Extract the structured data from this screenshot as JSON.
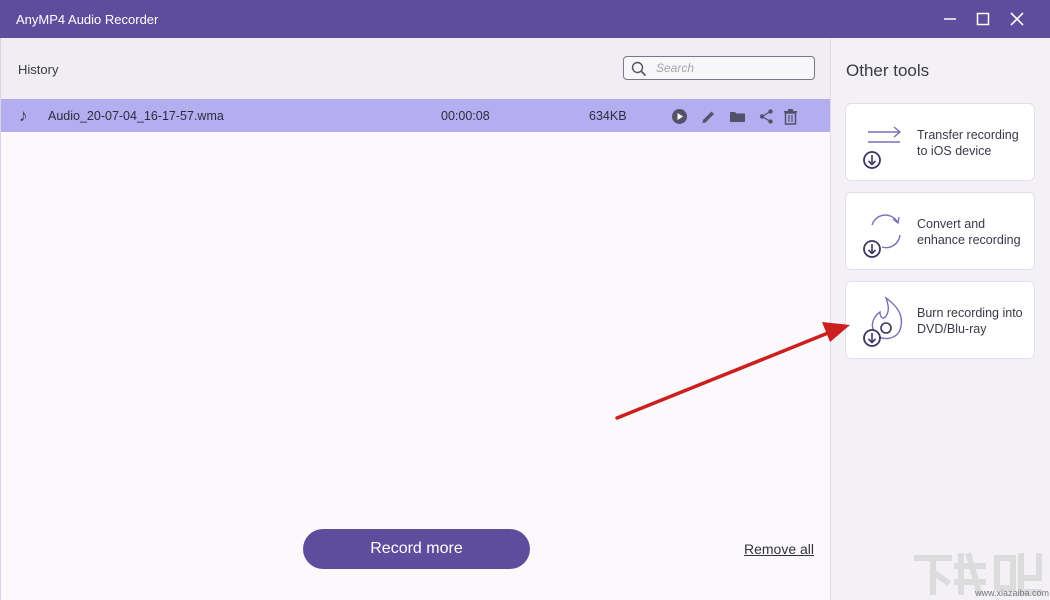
{
  "window": {
    "title": "AnyMP4 Audio Recorder"
  },
  "history": {
    "label": "History",
    "search_placeholder": "Search",
    "items": [
      {
        "filename": "Audio_20-07-04_16-17-57.wma",
        "duration": "00:00:08",
        "size": "634KB"
      }
    ]
  },
  "footer": {
    "record_more": "Record more",
    "remove_all": "Remove all"
  },
  "sidebar": {
    "title": "Other tools",
    "tools": [
      {
        "label": "Transfer recording to iOS device",
        "icon": "transfer-icon"
      },
      {
        "label": "Convert and enhance recording",
        "icon": "convert-icon"
      },
      {
        "label": "Burn recording into DVD/Blu-ray",
        "icon": "burn-icon"
      }
    ]
  },
  "watermark": {
    "text": "www.xiazaiba.com"
  },
  "colors": {
    "titlebar": "#5e4d9c",
    "selected_row": "#b4aef0",
    "accent": "#5e4d9c",
    "annotation_arrow": "#cc1f1f"
  }
}
